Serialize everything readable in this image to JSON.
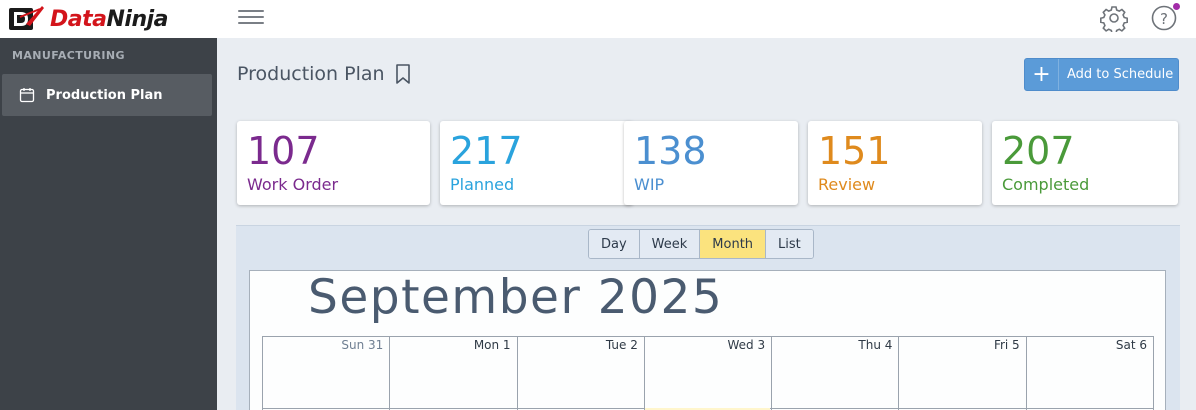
{
  "brand": {
    "name_part1": "Data",
    "name_part2": "Ninja"
  },
  "header": {
    "title": "Production Plan",
    "add_button_label": "Add to Schedule"
  },
  "sidebar": {
    "section": "MANUFACTURING",
    "items": [
      {
        "label": "Production Plan",
        "icon": "calendar-icon",
        "active": true
      }
    ]
  },
  "stats": [
    {
      "value": "107",
      "label": "Work Order",
      "color": "#7b2a8e"
    },
    {
      "value": "217",
      "label": "Planned",
      "color": "#2aa3dd"
    },
    {
      "value": "138",
      "label": "WIP",
      "color": "#4b8fd0"
    },
    {
      "value": "151",
      "label": "Review",
      "color": "#df8a1d"
    },
    {
      "value": "207",
      "label": "Completed",
      "color": "#4a9a3a"
    }
  ],
  "calendar": {
    "views": [
      "Day",
      "Week",
      "Month",
      "List"
    ],
    "active_view": "Month",
    "month_title": "September 2025",
    "days": [
      "Sun 31",
      "Mon 1",
      "Tue 2",
      "Wed 3",
      "Thu 4",
      "Fri 5",
      "Sat 6"
    ]
  },
  "icons": {
    "menu": "hamburger-icon",
    "settings": "gear-icon",
    "help": "help-icon",
    "bookmark": "bookmark-icon",
    "add": "plus-icon"
  },
  "colors": {
    "accent": "#5b9bd8",
    "active_tab": "#fbe37e",
    "sidebar": "#3d4248",
    "notification": "#a22ca8"
  }
}
